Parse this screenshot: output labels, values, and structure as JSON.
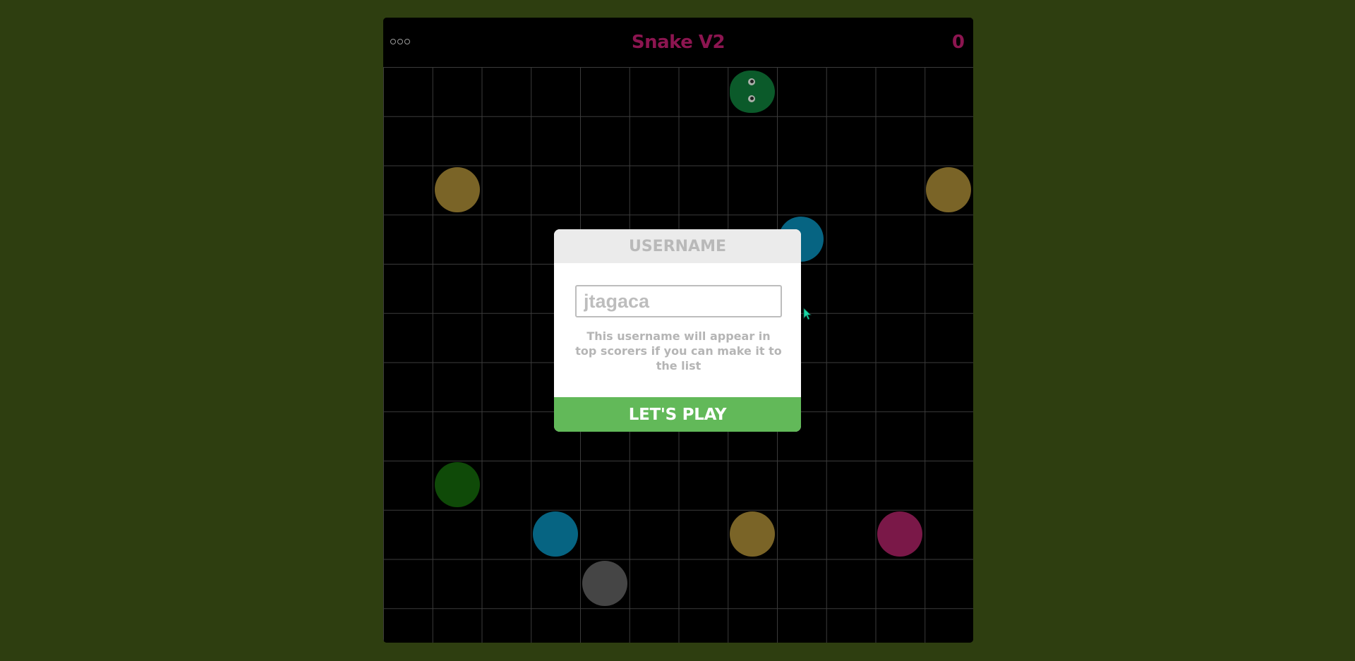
{
  "header": {
    "title": "Snake V2",
    "score": "0",
    "menu_icon": "more-dots-icon"
  },
  "board": {
    "columns": 12,
    "rows": 12,
    "snake_head": {
      "col": 7,
      "row": 0,
      "color": "#0b5a2a"
    },
    "food": [
      {
        "col": 1,
        "row": 2,
        "color": "#7a6427"
      },
      {
        "col": 11,
        "row": 2,
        "color": "#7a6427"
      },
      {
        "col": 8,
        "row": 3,
        "color": "#066482"
      },
      {
        "col": 1,
        "row": 8,
        "color": "#0f4a08"
      },
      {
        "col": 3,
        "row": 9,
        "color": "#066482"
      },
      {
        "col": 7,
        "row": 9,
        "color": "#7a6427"
      },
      {
        "col": 10,
        "row": 9,
        "color": "#7a1848"
      },
      {
        "col": 4,
        "row": 10,
        "color": "#454545"
      }
    ]
  },
  "modal": {
    "title": "USERNAME",
    "input_placeholder": "jtagaca",
    "helper_text": "This username will appear in top scorers if you can make it to the list",
    "play_button": "LET'S PLAY"
  },
  "colors": {
    "page_background": "#2e3e10",
    "title_color": "#8c1550",
    "play_button": "#62b959"
  }
}
